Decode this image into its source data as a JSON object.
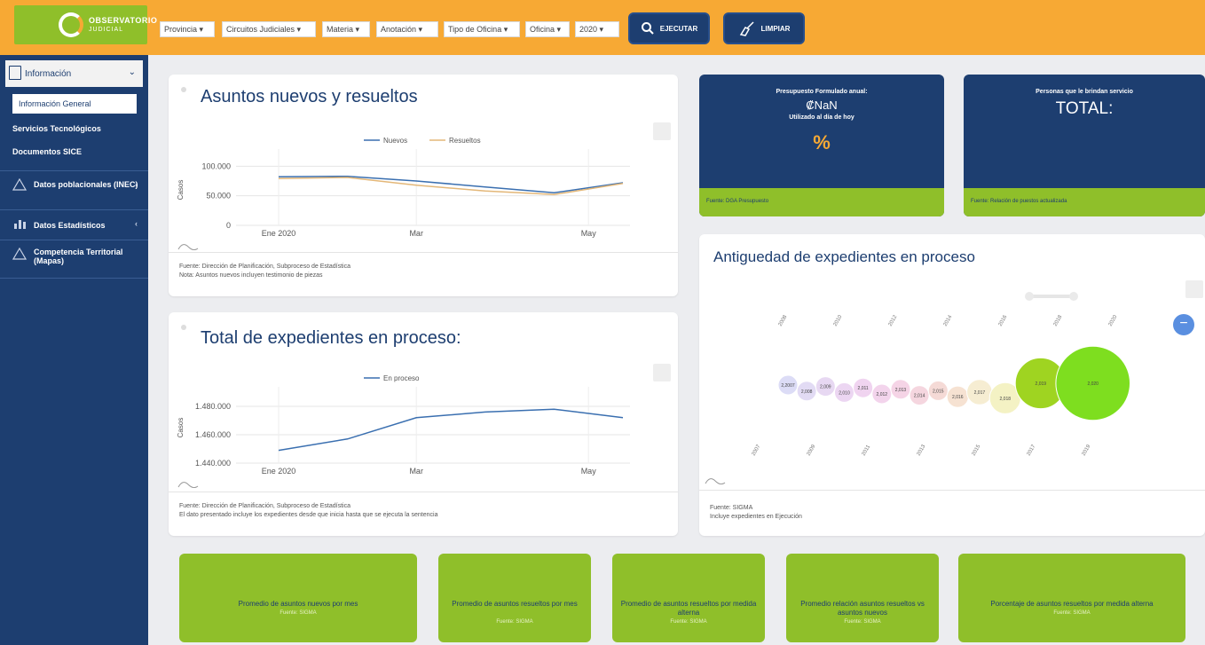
{
  "header": {
    "logo": {
      "title": "OBSERVATORIO",
      "subtitle": "JUDICIAL"
    },
    "filters": [
      "Provincia",
      "Circuitos Judiciales",
      "Materia",
      "Anotación",
      "Tipo de Oficina",
      "Oficina",
      "2020"
    ],
    "execute_label": "EJECUTAR",
    "clear_label": "LIMPIAR"
  },
  "sidebar": {
    "section_label": "Información",
    "items": [
      "Información General",
      "Servicios Tecnológicos",
      "Documentos SICE"
    ],
    "groups": [
      "Datos poblacionales (INEC)",
      "Datos Estadísticos",
      "Competencia Territorial (Mapas)"
    ]
  },
  "card_new_resolved": {
    "title": "Asuntos nuevos y resueltos",
    "source": "Fuente: Dirección de Planificación, Subproceso de Estadística",
    "note": "Nota: Asuntos nuevos incluyen testimonio de piezas"
  },
  "card_in_process": {
    "title": "Total de expedientes en proceso:",
    "source": "Fuente: Dirección de Planificación, Subproceso de Estadística",
    "note": "El dato presentado incluye los expedientes desde que inicia hasta que se ejecuta la sentencia"
  },
  "stat_budget": {
    "title": "Presupuesto Formulado anual:",
    "value": "₡NaN",
    "sub": "Utilizado al día de hoy",
    "percent": "%",
    "source": "Fuente: DGA Presupuesto"
  },
  "stat_staff": {
    "title": "Personas que le brindan servicio",
    "value": "TOTAL:",
    "source": "Fuente: Relación de puestos actualizada"
  },
  "card_age": {
    "title": "Antiguedad de expedientes en proceso",
    "source": "Fuente: SIGMA",
    "note": "Incluye expedientes en Ejecución"
  },
  "bottom_cards": [
    {
      "label": "Promedio de asuntos nuevos por mes",
      "source": "Fuente: SIGMA"
    },
    {
      "label": "Promedio de asuntos resueltos por mes",
      "source": "Fuente: SIGMA"
    },
    {
      "label": "Promedio de asuntos resueltos por medida alterna",
      "source": "Fuente: SIGMA"
    },
    {
      "label": "Promedio relación asuntos resueltos vs asuntos nuevos",
      "source": "Fuente: SIGMA"
    },
    {
      "label": "Porcentaje de asuntos resueltos por medida alterna",
      "source": "Fuente: SIGMA"
    }
  ],
  "chart_data": [
    {
      "type": "line",
      "title": "Asuntos nuevos y resueltos",
      "ylabel": "Casos",
      "x_ticks": [
        "Ene 2020",
        "Mar",
        "May"
      ],
      "y_ticks": [
        "100.000",
        "50.000",
        "0"
      ],
      "ylim": [
        0,
        120000
      ],
      "x": [
        0,
        1,
        2,
        3,
        4,
        5
      ],
      "series": [
        {
          "name": "Nuevos",
          "color": "#3a6fb0",
          "values": [
            82000,
            83000,
            75000,
            65000,
            55000,
            72000
          ]
        },
        {
          "name": "Resueltos",
          "color": "#e3b778",
          "values": [
            79000,
            81000,
            68000,
            58000,
            52000,
            71000
          ]
        }
      ],
      "legend": "top",
      "grid": true
    },
    {
      "type": "line",
      "title": "Total de expedientes en proceso:",
      "ylabel": "Casos",
      "x_ticks": [
        "Ene 2020",
        "Mar",
        "May"
      ],
      "y_ticks": [
        "1.480.000",
        "1.460.000",
        "1.440.000"
      ],
      "ylim": [
        1440000,
        1490000
      ],
      "x": [
        0,
        1,
        2,
        3,
        4,
        5
      ],
      "series": [
        {
          "name": "En proceso",
          "color": "#3a6fb0",
          "values": [
            1449000,
            1457000,
            1472000,
            1476000,
            1478000,
            1472000
          ]
        }
      ],
      "legend": "top",
      "grid": true
    },
    {
      "type": "scatter",
      "title": "Antiguedad de expedientes en proceso",
      "years": [
        "2007",
        "2008",
        "2009",
        "2010",
        "2011",
        "2012",
        "2013",
        "2014",
        "2015",
        "2016",
        "2017",
        "2018",
        "2019",
        "2020"
      ],
      "bubble_labels": [
        "2,2007",
        "2,008",
        "2,009",
        "2,010",
        "2,011",
        "2,012",
        "2,013",
        "2,014",
        "2,015",
        "2,016",
        "2,017",
        "2,018",
        "2,019",
        "2,020"
      ],
      "sizes": [
        1,
        1,
        1,
        1,
        1,
        1,
        1,
        1,
        1,
        1.1,
        1.3,
        1.6,
        2.6,
        3.8
      ],
      "colors": [
        "#dcdcf6",
        "#e2dbf4",
        "#e7d8f2",
        "#ecd6f2",
        "#f0d4f0",
        "#f3d4ec",
        "#f5d4e6",
        "#f5d6df",
        "#f5dad6",
        "#f6e2d2",
        "#f6edd2",
        "#f4f2c4",
        "#9fd421",
        "#7ede1f"
      ],
      "top_ticks": [
        "2008",
        "2010",
        "2012",
        "2014",
        "2016",
        "2018",
        "2020"
      ],
      "bottom_ticks": [
        "2007",
        "2009",
        "2011",
        "2013",
        "2015",
        "2017",
        "2019"
      ]
    }
  ]
}
